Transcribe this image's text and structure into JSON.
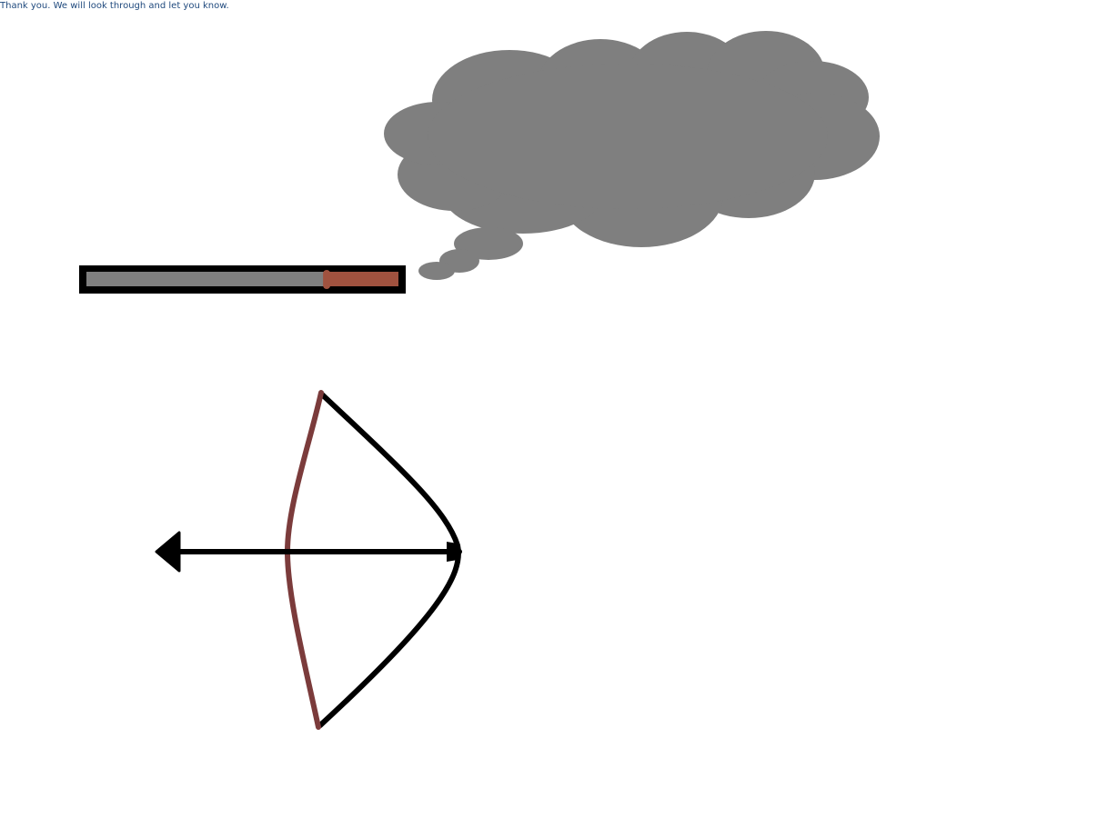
{
  "status": {
    "message": "Thank you. We will look through and let you know."
  },
  "colors": {
    "message_text": "#1f497d",
    "cloud": "#7f7f7f",
    "bar_frame": "#000000",
    "bar_track": "#7f7f7f",
    "bar_fill": "#a0523f",
    "bow_limb": "#7b3b3b",
    "bow_string": "#000000",
    "arrow": "#000000"
  },
  "power_meter": {
    "level": 0.23
  },
  "icons": {
    "cloud": "thought-cloud-icon",
    "bow": "bow-icon",
    "arrow": "arrow-icon"
  }
}
